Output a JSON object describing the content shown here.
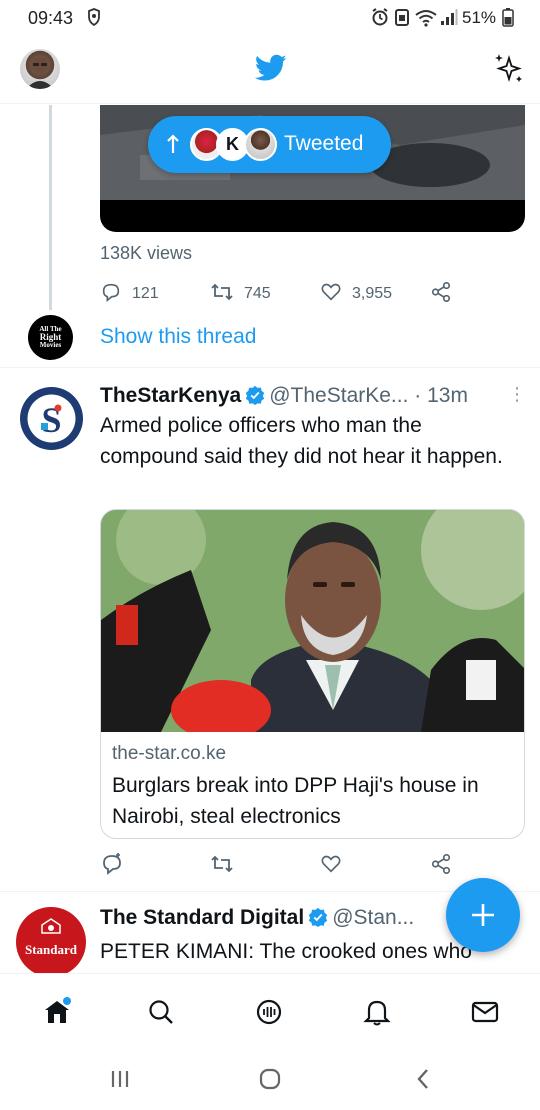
{
  "status_bar": {
    "time": "09:43",
    "battery": "51%"
  },
  "previous_tweet": {
    "retweeted_pill_label": "Tweeted",
    "pill_letter": "K",
    "views": "138K views",
    "replies": "121",
    "retweets": "745",
    "likes": "3,955",
    "show_thread": "Show this thread",
    "avatar_text": [
      "All The",
      "Right",
      "Movies"
    ]
  },
  "tweet": {
    "name": "TheStarKenya",
    "handle": "@TheStarKe...",
    "time": "· 13m",
    "text": "Armed police officers who man the compound said they did not hear it happen.",
    "card": {
      "domain": "the-star.co.ke",
      "headline": "Burglars break into DPP Haji's house in Nairobi, steal electronics"
    }
  },
  "next_tweet": {
    "name": "The Standard Digital",
    "handle": "@Stan...",
    "text": "PETER KIMANI: The crooked ones who",
    "avatar_label": "Standard"
  },
  "colors": {
    "twitter_blue": "#1d9bf0",
    "secondary_text": "#536471",
    "divider": "#eff3f4"
  },
  "icons": {
    "app_logo": "twitter-bird-icon",
    "sparkle": "sparkle-icon",
    "compose": "plus-icon"
  }
}
